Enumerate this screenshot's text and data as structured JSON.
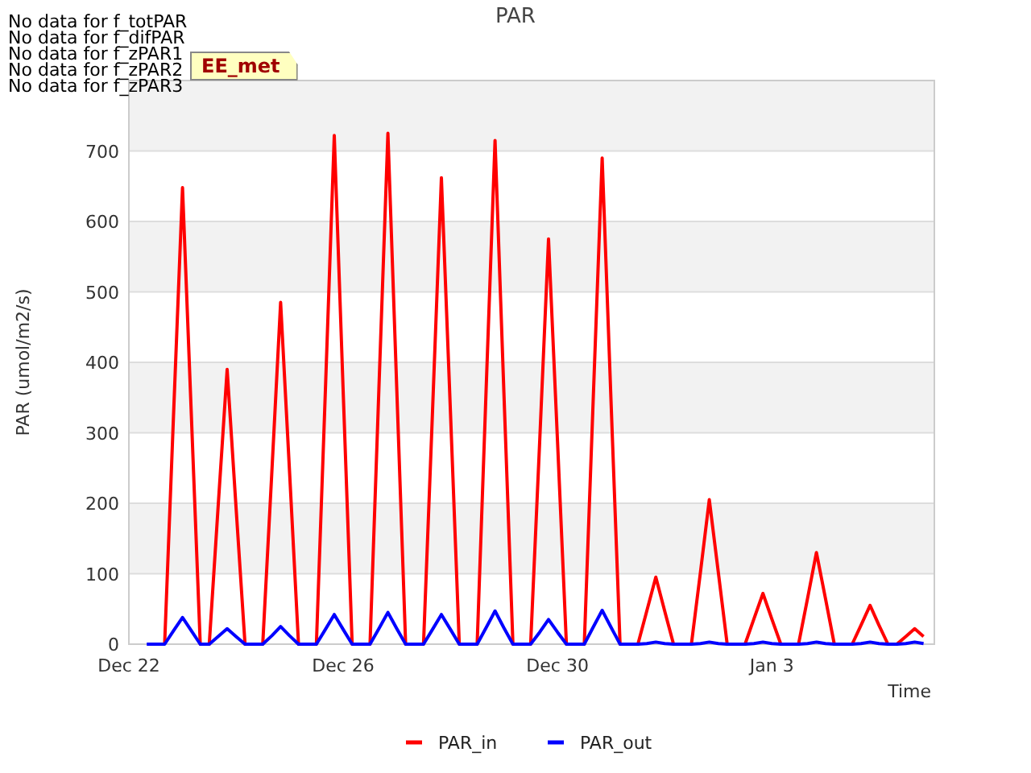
{
  "notes": [
    "No data for f_totPAR",
    "No data for f_difPAR",
    "No data for f_zPAR1",
    "No data for f_zPAR2",
    "No data for f_zPAR3"
  ],
  "badge": "EE_met",
  "chart_data": {
    "type": "line",
    "grid": true,
    "legend": "bottom",
    "title": "PAR",
    "xlabel": "Time",
    "ylabel": "PAR (umol/m2/s)",
    "ylim": [
      0,
      800
    ],
    "yticks": [
      0,
      100,
      200,
      300,
      400,
      500,
      600,
      700
    ],
    "categories": [
      "Dec 22",
      null,
      null,
      null,
      null,
      null,
      null,
      null,
      null,
      null,
      null,
      null,
      null,
      null,
      null,
      null,
      null,
      null,
      null,
      null,
      null,
      null,
      null,
      null,
      "Dec 26",
      null,
      null,
      null,
      null,
      null,
      null,
      null,
      null,
      null,
      null,
      null,
      null,
      null,
      null,
      null,
      null,
      null,
      null,
      null,
      null,
      null,
      null,
      null,
      "Dec 30",
      null,
      null,
      null,
      null,
      null,
      null,
      null,
      null,
      null,
      null,
      null,
      null,
      null,
      null,
      null,
      null,
      null,
      null,
      null,
      null,
      null,
      null,
      null,
      "Jan 3",
      null,
      null,
      null,
      null,
      null,
      null,
      null,
      null,
      null,
      null,
      null,
      null,
      null,
      null,
      null,
      null,
      null
    ],
    "series": [
      {
        "name": "PAR_in",
        "color": "#ff0000",
        "values": [
          null,
          null,
          null,
          null,
          0,
          324,
          648,
          324,
          0,
          0,
          195,
          390,
          195,
          0,
          0,
          0,
          242,
          485,
          242,
          0,
          0,
          0,
          361,
          722,
          361,
          0,
          0,
          0,
          362,
          725,
          362,
          0,
          0,
          0,
          331,
          662,
          331,
          0,
          0,
          0,
          357,
          715,
          357,
          0,
          0,
          0,
          287,
          575,
          287,
          0,
          0,
          0,
          345,
          690,
          345,
          0,
          0,
          0,
          47,
          95,
          47,
          0,
          0,
          0,
          102,
          205,
          102,
          0,
          0,
          0,
          36,
          72,
          36,
          0,
          0,
          0,
          65,
          130,
          65,
          0,
          0,
          0,
          27,
          55,
          27,
          0,
          0,
          11,
          22,
          11
        ]
      },
      {
        "name": "PAR_out",
        "color": "#0000ff",
        "values": [
          null,
          null,
          0,
          0,
          0,
          19,
          38,
          19,
          0,
          0,
          11,
          22,
          11,
          0,
          0,
          0,
          12,
          25,
          12,
          0,
          0,
          0,
          21,
          42,
          21,
          0,
          0,
          0,
          22,
          45,
          22,
          0,
          0,
          0,
          21,
          42,
          21,
          0,
          0,
          0,
          23,
          47,
          23,
          0,
          0,
          0,
          17,
          35,
          17,
          0,
          0,
          0,
          24,
          48,
          24,
          0,
          0,
          0,
          1,
          3,
          1,
          0,
          0,
          0,
          1,
          3,
          1,
          0,
          0,
          0,
          1,
          3,
          1,
          0,
          0,
          0,
          1,
          3,
          1,
          0,
          0,
          0,
          1,
          3,
          1,
          0,
          0,
          1,
          3,
          1
        ]
      }
    ]
  }
}
